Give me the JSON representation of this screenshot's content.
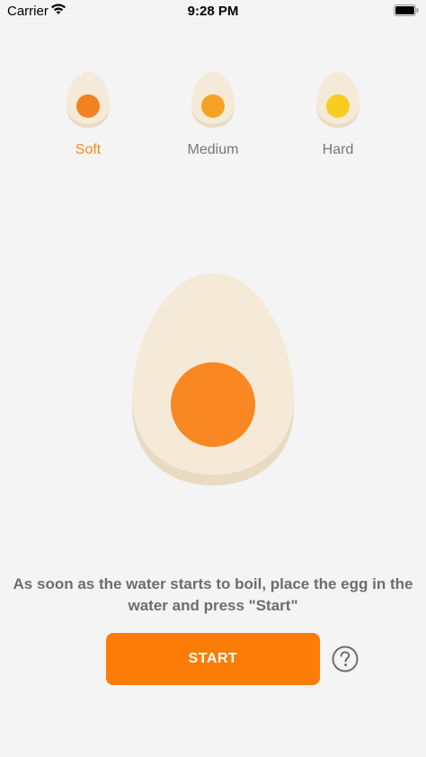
{
  "status_bar": {
    "carrier": "Carrier",
    "time": "9:28 PM"
  },
  "egg_options": [
    {
      "label": "Soft",
      "yolk_color": "#f38220",
      "selected": true
    },
    {
      "label": "Medium",
      "yolk_color": "#f6a227",
      "selected": false
    },
    {
      "label": "Hard",
      "yolk_color": "#f7cd21",
      "selected": false
    }
  ],
  "main_egg": {
    "shell_color": "#f5ead8",
    "shadow_color": "#e8dbc2",
    "yolk_color": "#f98722"
  },
  "instructions": "As soon as the water starts to boil, place the egg in the water and press \"Start\"",
  "start_button": {
    "label": "START",
    "color": "#fb7c07"
  },
  "accent_color": "#f08c1f"
}
